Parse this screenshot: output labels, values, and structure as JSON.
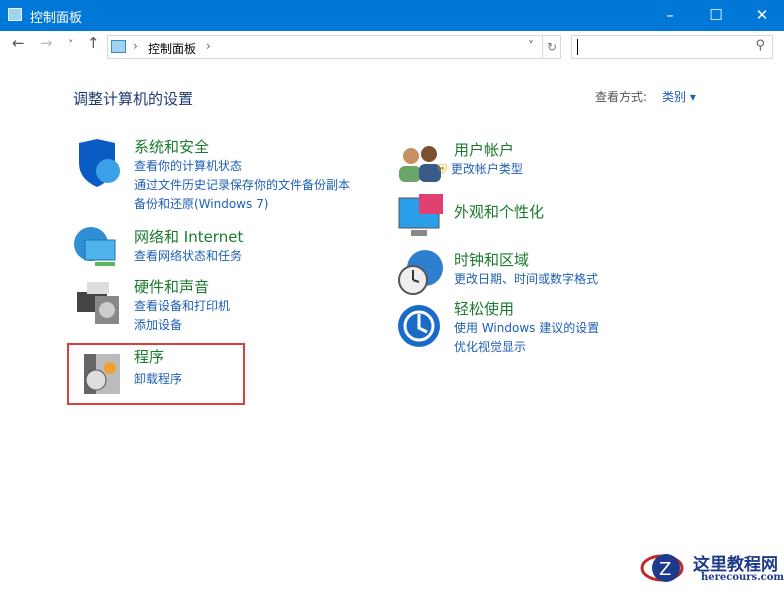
{
  "window": {
    "title": "控制面板",
    "minimize": "–",
    "maximize": "☐",
    "close": "✕"
  },
  "nav": {
    "back": "←",
    "forward": "→",
    "recent": "˅",
    "up": "↑",
    "breadcrumb": "控制面板",
    "sep": "›",
    "dropdown": "˅",
    "refresh": "↻",
    "search_icon": "⚲",
    "search_placeholder": ""
  },
  "main": {
    "title": "调整计算机的设置",
    "view_by_label": "查看方式:",
    "view_by_value": "类别",
    "view_by_arrow": "▾"
  },
  "categories_left": [
    {
      "title": "系统和安全",
      "links": [
        "查看你的计算机状态",
        "通过文件历史记录保存你的文件备份副本",
        "备份和还原(Windows 7)"
      ]
    },
    {
      "title": "网络和 Internet",
      "links": [
        "查看网络状态和任务"
      ]
    },
    {
      "title": "硬件和声音",
      "links": [
        "查看设备和打印机",
        "添加设备"
      ]
    },
    {
      "title": "程序",
      "links": [
        "卸载程序"
      ]
    }
  ],
  "categories_right": [
    {
      "title": "用户帐户",
      "links": [
        "更改帐户类型"
      ]
    },
    {
      "title": "外观和个性化",
      "links": []
    },
    {
      "title": "时钟和区域",
      "links": [
        "更改日期、时间或数字格式"
      ]
    },
    {
      "title": "轻松使用",
      "links": [
        "使用 Windows 建议的设置",
        "优化视觉显示"
      ]
    }
  ],
  "watermark": {
    "name": "这里教程网",
    "url": "herecours.com"
  }
}
